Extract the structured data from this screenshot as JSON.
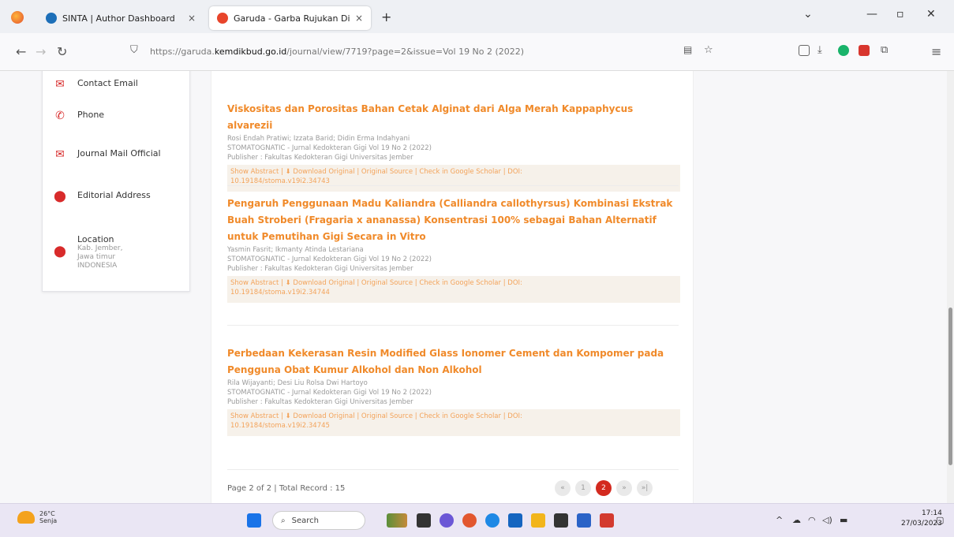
{
  "browser": {
    "tabs": [
      {
        "label": "SINTA | Author Dashboard",
        "close": "×"
      },
      {
        "label": "Garuda - Garba Rujukan Digital",
        "close": "×"
      }
    ],
    "new_tab": "+",
    "url_prefix": "https://garuda.",
    "url_host": "kemdikbud.go.id",
    "url_path": "/journal/view/7719?page=2&issue=Vol 19 No 2 (2022)"
  },
  "sidebar": {
    "items": [
      {
        "label": "Contact Email",
        "icon": "mail-icon"
      },
      {
        "label": "Phone",
        "icon": "phone-icon"
      },
      {
        "label": "Journal Mail Official",
        "icon": "mail-icon"
      },
      {
        "label": "Editorial Address",
        "icon": "location-icon"
      },
      {
        "label": "Location",
        "icon": "location-icon",
        "sub": [
          "Kab. Jember,",
          "Jawa timur",
          "INDONESIA"
        ]
      }
    ]
  },
  "articles": [
    {
      "title": "Viskositas dan Porositas Bahan Cetak Alginat dari Alga Merah Kappaphycus alvarezii",
      "authors": "Rosi Endah Pratiwi; Izzata Barid; Didin Erma Indahyani",
      "journal": "STOMATOGNATIC - Jurnal Kedokteran Gigi Vol 19 No 2 (2022)",
      "publisher": "Publisher : Fakultas Kedokteran Gigi Universitas Jember",
      "links": "Show Abstract | ⬇ Download Original | Original Source | Check in Google Scholar | DOI:",
      "doi": "10.19184/stoma.v19i2.34743"
    },
    {
      "title": "Pengaruh Penggunaan Madu Kaliandra (Calliandra callothyrsus) Kombinasi Ekstrak Buah Stroberi (Fragaria x ananassa) Konsentrasi 100% sebagai Bahan Alternatif untuk Pemutihan Gigi Secara in Vitro",
      "authors": "Yasmin Fasrit; Ikmanty Atinda Lestariana",
      "journal": "STOMATOGNATIC - Jurnal Kedokteran Gigi Vol 19 No 2 (2022)",
      "publisher": "Publisher : Fakultas Kedokteran Gigi Universitas Jember",
      "links": "Show Abstract | ⬇ Download Original | Original Source | Check in Google Scholar | DOI:",
      "doi": "10.19184/stoma.v19i2.34744"
    },
    {
      "title": "Perbedaan Kekerasan Resin Modified Glass Ionomer Cement dan Kompomer pada Pengguna Obat Kumur Alkohol dan Non Alkohol",
      "authors": "Rila Wijayanti; Desi Liu Rolsa Dwi Hartoyo",
      "journal": "STOMATOGNATIC - Jurnal Kedokteran Gigi Vol 19 No 2 (2022)",
      "publisher": "Publisher : Fakultas Kedokteran Gigi Universitas Jember",
      "links": "Show Abstract | ⬇ Download Original | Original Source | Check in Google Scholar | DOI:",
      "doi": "10.19184/stoma.v19i2.34745"
    }
  ],
  "pagination": {
    "summary": "Page 2 of 2 | Total Record : 15",
    "buttons": [
      "«",
      "1",
      "2",
      "»",
      "»|"
    ]
  },
  "taskbar": {
    "temp": "26°C",
    "weather": "Senja",
    "search": "Search",
    "time": "17:14",
    "date": "27/03/2023"
  },
  "colors": {
    "accent": "#f08a2a",
    "active_page": "#d32a1f",
    "icon_red": "#d82b2b"
  }
}
